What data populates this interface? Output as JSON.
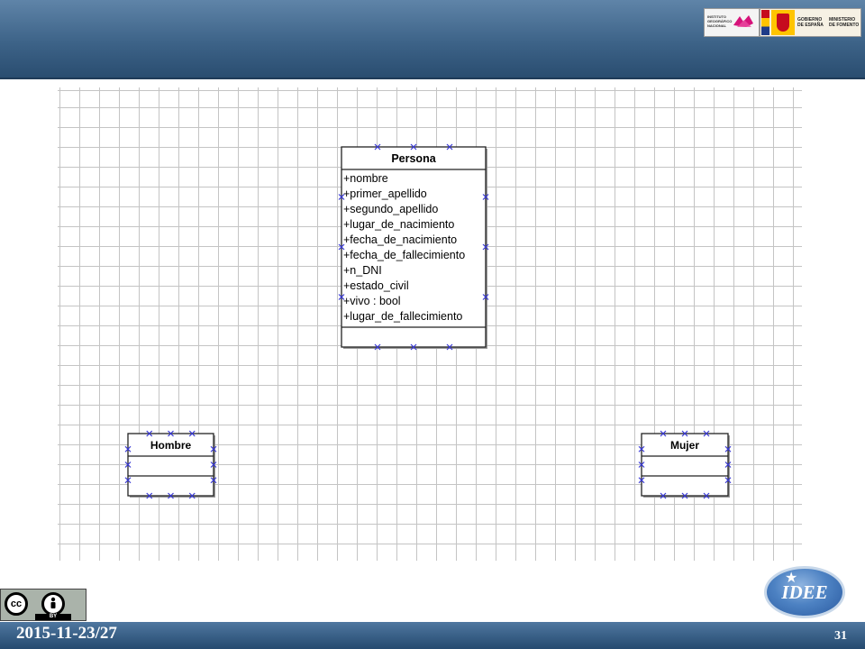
{
  "header": {
    "logo_ign_text": "INSTITUTO GEOGRÁFICO NACIONAL",
    "logo_gob_text1": "GOBIERNO DE ESPAÑA",
    "logo_gob_text2": "MINISTERIO DE FOMENTO"
  },
  "diagram": {
    "classes": [
      {
        "id": "persona",
        "name": "Persona",
        "attributes": [
          "+nombre",
          "+primer_apellido",
          "+segundo_apellido",
          "+lugar_de_nacimiento",
          "+fecha_de_nacimiento",
          "+fecha_de_fallecimiento",
          "+n_DNI",
          "+estado_civil",
          "+vivo : bool",
          "+lugar_de_fallecimiento"
        ]
      },
      {
        "id": "hombre",
        "name": "Hombre",
        "attributes": []
      },
      {
        "id": "mujer",
        "name": "Mujer",
        "attributes": []
      }
    ],
    "handle_icon": "x-handle-icon"
  },
  "footer": {
    "date": "2015-11-23/27",
    "page": "31",
    "license_label": "BY",
    "logo_text": "IDEE"
  }
}
